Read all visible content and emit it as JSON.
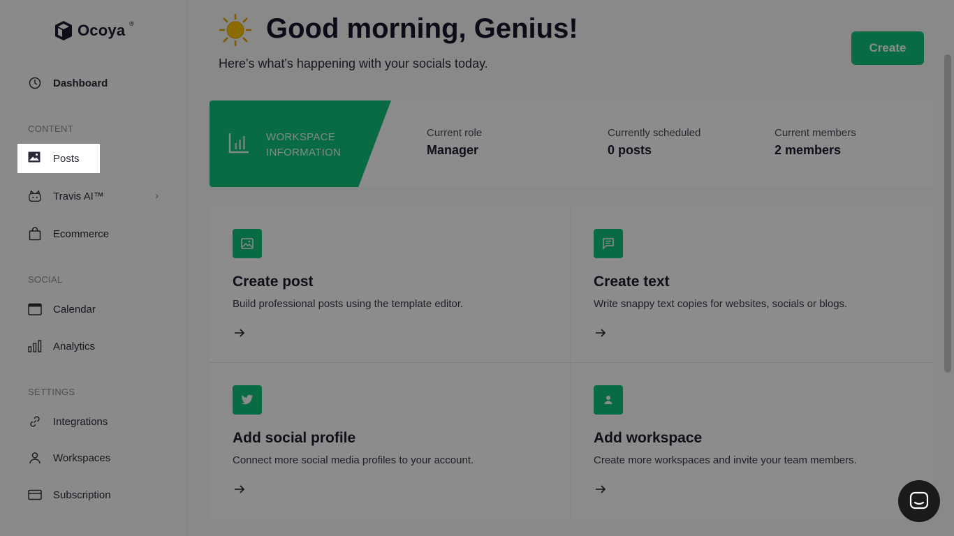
{
  "brand": {
    "name": "Ocoya",
    "reg": "®"
  },
  "sidebar": {
    "dashboard": "Dashboard",
    "sections": {
      "content": "CONTENT",
      "social": "SOCIAL",
      "settings": "SETTINGS"
    },
    "items": {
      "posts": "Posts",
      "travis": "Travis AI™",
      "ecommerce": "Ecommerce",
      "calendar": "Calendar",
      "analytics": "Analytics",
      "integrations": "Integrations",
      "workspaces": "Workspaces",
      "subscription": "Subscription"
    }
  },
  "header": {
    "greeting": "Good morning, Genius!",
    "subtitle": "Here's what's happening with your socials today.",
    "create_label": "Create"
  },
  "workspace": {
    "banner_line1": "WORKSPACE",
    "banner_line2": "INFORMATION",
    "stats": [
      {
        "label": "Current role",
        "value": "Manager"
      },
      {
        "label": "Currently scheduled",
        "value": "0 posts"
      },
      {
        "label": "Current members",
        "value": "2 members"
      }
    ]
  },
  "tiles": [
    {
      "title": "Create post",
      "desc": "Build professional posts using the template editor.",
      "icon": "image-icon"
    },
    {
      "title": "Create text",
      "desc": "Write snappy text copies for websites, socials or blogs.",
      "icon": "message-icon"
    },
    {
      "title": "Add social profile",
      "desc": "Connect more social media profiles to your account.",
      "icon": "twitter-icon"
    },
    {
      "title": "Add workspace",
      "desc": "Create more workspaces and invite your team members.",
      "icon": "user-icon"
    }
  ],
  "colors": {
    "accent": "#10c47a",
    "overlay": "rgba(0,0,0,0.45)"
  }
}
